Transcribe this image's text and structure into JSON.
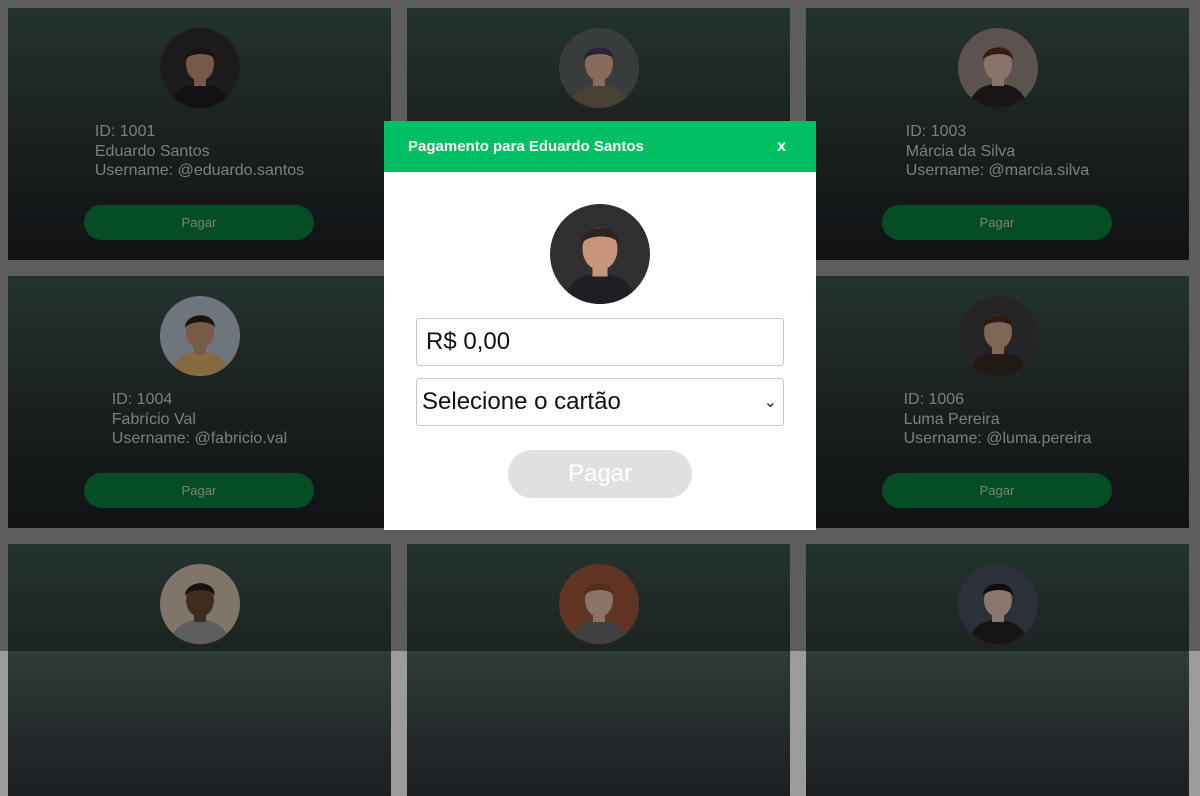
{
  "cards": [
    {
      "id": "ID: 1001",
      "name": "Eduardo Santos",
      "username": "Username: @eduardo.santos",
      "button": "Pagar",
      "avatar": "person-dark-hair-icon",
      "skin": "#c99578",
      "hair": "#2b2420",
      "bg": "#2f2f31",
      "cloth": "#1e1f22"
    },
    {
      "id": "",
      "name": "",
      "username": "",
      "button": "",
      "avatar": "person-glasses-icon",
      "skin": "#e2b597",
      "hair": "#4a3b5f",
      "bg": "#5e6467",
      "cloth": "#7b6a55"
    },
    {
      "id": "ID: 1003",
      "name": "Márcia da Silva",
      "username": "Username: @marcia.silva",
      "button": "Pagar",
      "avatar": "person-long-hair-icon",
      "skin": "#e3c2b4",
      "hair": "#5a2e27",
      "bg": "#9a8b86",
      "cloth": "#2c2528"
    },
    {
      "id": "ID: 1004",
      "name": "Fabrício Val",
      "username": "Username: @fabricio.val",
      "button": "Pagar",
      "avatar": "person-beard-icon",
      "skin": "#c99779",
      "hair": "#2a221c",
      "bg": "#b9c4cf",
      "cloth": "#e2b06a"
    },
    {
      "id": "",
      "name": "",
      "username": "",
      "button": "",
      "avatar": "person-icon",
      "skin": "#c99578",
      "hair": "#2b2420",
      "bg": "#2f2f31",
      "cloth": "#1e1f22"
    },
    {
      "id": "ID: 1006",
      "name": "Luma Pereira",
      "username": "Username: @luma.pereira",
      "button": "Pagar",
      "avatar": "person-brown-hair-icon",
      "skin": "#d7aa8f",
      "hair": "#4b2d1f",
      "bg": "#3d3d40",
      "cloth": "#3a2a22"
    },
    {
      "id": "",
      "name": "",
      "username": "",
      "button": "",
      "avatar": "person-smiling-icon",
      "skin": "#6b4a34",
      "hair": "#2a1d16",
      "bg": "#d6c3b0",
      "cloth": "#9b9b9b"
    },
    {
      "id": "",
      "name": "",
      "username": "",
      "button": "",
      "avatar": "person-red-hair-icon",
      "skin": "#e6c1a8",
      "hair": "#8a4a2d",
      "bg": "#a0553a",
      "cloth": "#6b6b6b"
    },
    {
      "id": "",
      "name": "",
      "username": "",
      "button": "",
      "avatar": "person-black-hair-icon",
      "skin": "#e8c8b5",
      "hair": "#1b1717",
      "bg": "#4a5060",
      "cloth": "#232325"
    }
  ],
  "modal": {
    "title": "Pagamento para Eduardo Santos",
    "close": "x",
    "amount_value": "R$ 0,00",
    "select_label": "Selecione o cartão",
    "pay_label": "Pagar",
    "avatar": "person-dark-hair-icon"
  },
  "colors": {
    "modal_header": "#00bf63",
    "card_button": "#07803f",
    "modal_pay_disabled": "#e0e0e0",
    "page_background": "#9b9b9b"
  }
}
